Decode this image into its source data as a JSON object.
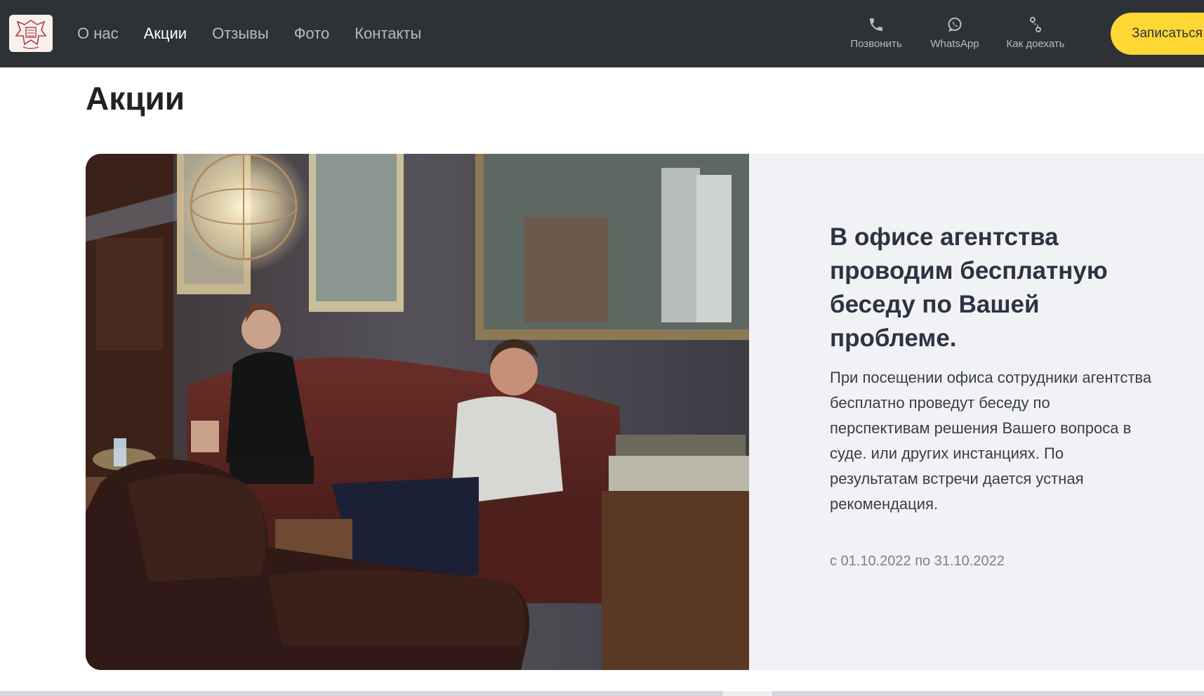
{
  "nav": {
    "items": [
      {
        "label": "О нас",
        "active": false
      },
      {
        "label": "Акции",
        "active": true
      },
      {
        "label": "Отзывы",
        "active": false
      },
      {
        "label": "Фото",
        "active": false
      },
      {
        "label": "Контакты",
        "active": false
      }
    ]
  },
  "header_actions": {
    "call": {
      "label": "Позвонить",
      "icon": "phone-icon"
    },
    "whatsapp": {
      "label": "WhatsApp",
      "icon": "whatsapp-icon"
    },
    "route": {
      "label": "Как доехать",
      "icon": "route-icon"
    },
    "book_button": "Записаться"
  },
  "page": {
    "title": "Акции"
  },
  "promo": {
    "heading": "В офисе агентства проводим бесплатную беседу по Вашей проблеме.",
    "body": "При посещении офиса сотрудники агентства бесплатно проведут беседу по перспективам решения Вашего вопроса в суде. или других инстанциях. По результатам встречи дается устная рекомендация.",
    "date_range": "с 01.10.2022 по 31.10.2022"
  },
  "colors": {
    "header_bg": "#2e3135",
    "accent_yellow": "#fdd835",
    "promo_panel_bg": "#f1f2f6",
    "heading_text": "#2f3241"
  }
}
